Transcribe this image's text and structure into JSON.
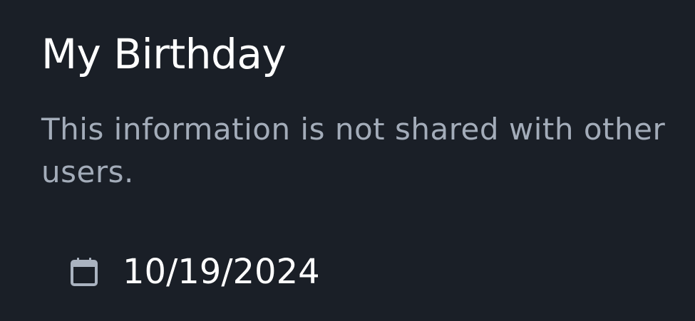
{
  "birthday": {
    "title": "My Birthday",
    "description": "This information is not shared with other users.",
    "date_value": "10/19/2024",
    "date_icon": "calendar-icon"
  },
  "colors": {
    "background": "#1a1f27",
    "title_text": "#ffffff",
    "description_text": "#a3acb9",
    "icon": "#aab3c0"
  }
}
